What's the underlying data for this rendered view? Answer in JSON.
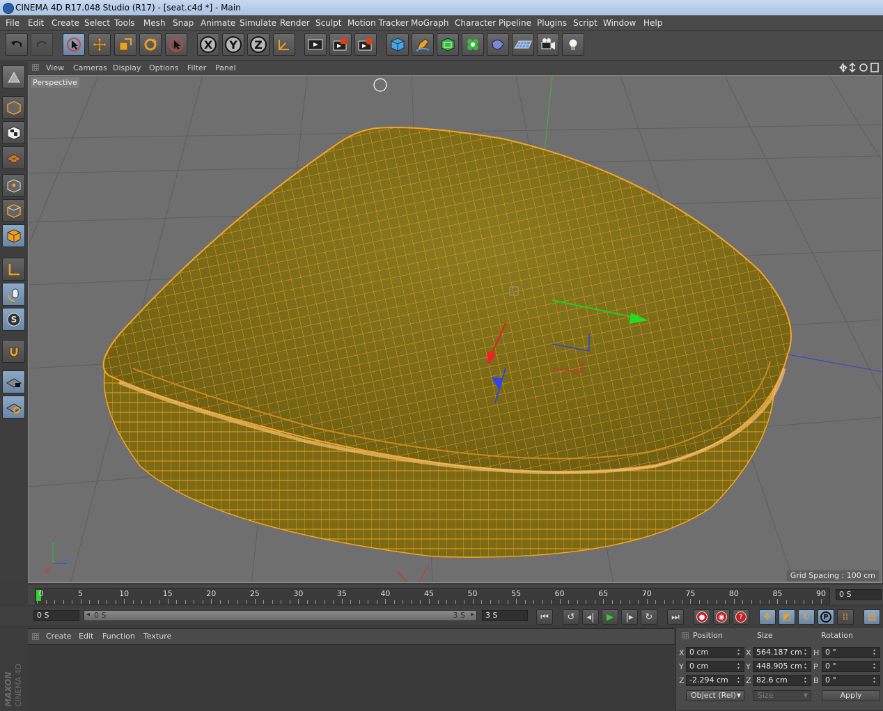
{
  "window": {
    "title": "CINEMA 4D R17.048 Studio (R17) - [seat.c4d *] - Main"
  },
  "menu": [
    "File",
    "Edit",
    "Create",
    "Select",
    "Tools",
    "Mesh",
    "Snap",
    "Animate",
    "Simulate",
    "Render",
    "Sculpt",
    "Motion Tracker",
    "MoGraph",
    "Character",
    "Pipeline",
    "Plugins",
    "Script",
    "Window",
    "Help"
  ],
  "toolbar": {
    "icons": [
      "undo-icon",
      "redo-icon",
      "live-selection-icon",
      "move-icon",
      "scale-icon",
      "rotate-icon",
      "last-tool-icon",
      "x-axis-lock-icon",
      "y-axis-lock-icon",
      "z-axis-lock-icon",
      "coordinate-system-icon",
      "render-view-icon",
      "render-picture-viewer-icon",
      "render-settings-icon",
      "cube-icon",
      "pen-icon",
      "subdivision-icon",
      "cloner-icon",
      "deformer-icon",
      "floor-icon",
      "camera-icon",
      "light-icon"
    ],
    "x_label": "X",
    "y_label": "Y",
    "z_label": "Z"
  },
  "viewport": {
    "menu": [
      "View",
      "Cameras",
      "Display",
      "Options",
      "Filter",
      "Panel"
    ],
    "camera_label": "Perspective",
    "grid_spacing": "Grid Spacing : 100 cm",
    "axis_x": "X",
    "axis_y": "Y",
    "axis_z": "Z",
    "colors": {
      "selection": "#f5a623",
      "background": "#6f6f6f"
    }
  },
  "timeline": {
    "ticks": [
      "0",
      "5",
      "10",
      "15",
      "20",
      "25",
      "30",
      "35",
      "40",
      "45",
      "50",
      "55",
      "60",
      "65",
      "70",
      "75",
      "80",
      "85",
      "90"
    ],
    "current_frame": "0 S",
    "start_field": "0 S",
    "range_start": "0 S",
    "range_end": "3 S",
    "end_field": "3 S"
  },
  "material_manager": {
    "menu": [
      "Create",
      "Edit",
      "Function",
      "Texture"
    ],
    "brand_top": "MAXON",
    "brand_bottom": "CINEMA 4D"
  },
  "coordinates": {
    "headers": {
      "position": "Position",
      "size": "Size",
      "rotation": "Rotation"
    },
    "rows": [
      {
        "pos_axis": "X",
        "pos": "0 cm",
        "size_axis": "X",
        "size": "564.187 cm",
        "rot_axis": "H",
        "rot": "0 °"
      },
      {
        "pos_axis": "Y",
        "pos": "0 cm",
        "size_axis": "Y",
        "size": "448.905 cm",
        "rot_axis": "P",
        "rot": "0 °"
      },
      {
        "pos_axis": "Z",
        "pos": "-2.294 cm",
        "size_axis": "Z",
        "size": "82.6 cm",
        "rot_axis": "B",
        "rot": "0 °"
      }
    ],
    "mode": "Object (Rel)",
    "size_mode": "Size",
    "apply": "Apply"
  }
}
